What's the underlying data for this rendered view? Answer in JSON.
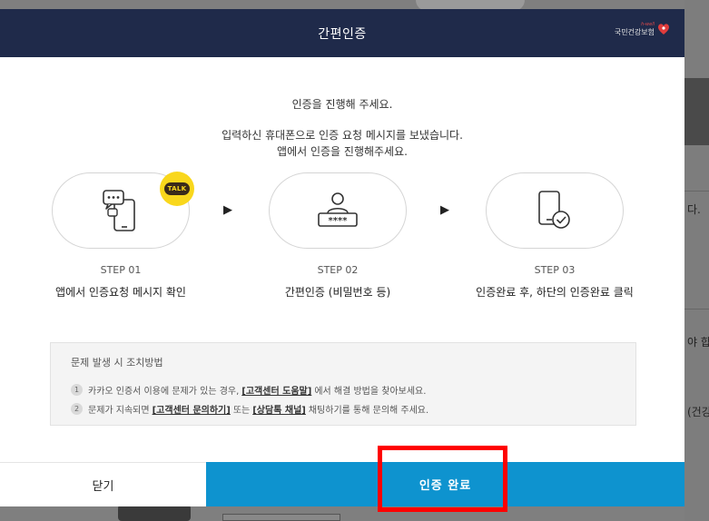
{
  "background": {
    "side_texts": [
      "다.",
      "야 합",
      "(건강"
    ]
  },
  "modal": {
    "title": "간편인증",
    "brand": {
      "small": "h-well",
      "name": "국민건강보험"
    },
    "intro_title": "인증을 진행해 주세요.",
    "intro_line1": "입력하신 휴대폰으로 인증 요청 메시지를 보냈습니다.",
    "intro_line2": "앱에서 인증을 진행해주세요.",
    "steps": [
      {
        "label": "STEP 01",
        "desc": "앱에서 인증요청 메시지 확인",
        "icon": "phone-chat-icon",
        "badge": "TALK"
      },
      {
        "label": "STEP 02",
        "desc": "간편인증 (비밀번호 등)",
        "icon": "user-password-icon"
      },
      {
        "label": "STEP 03",
        "desc": "인증완료 후, 하단의 인증완료 클릭",
        "icon": "phone-check-icon"
      }
    ],
    "help": {
      "title": "문제 발생 시 조치방법",
      "item1": {
        "num": "1",
        "pre": "카카오 인증서 이용에 문제가 있는 경우,",
        "link": "[고객센터 도움말]",
        "post": "에서 해결 방법을 찾아보세요."
      },
      "item2": {
        "num": "2",
        "pre": "문제가 지속되면",
        "link1": "[고객센터 문의하기]",
        "mid": "또는",
        "link2": "[상담톡 채널]",
        "post": "채팅하기를 통해 문의해 주세요."
      }
    },
    "buttons": {
      "close": "닫기",
      "done": "인증 완료"
    }
  },
  "colors": {
    "header": "#1f2a4a",
    "primary": "#0e93cf",
    "highlight": "#ff0000",
    "kakao": "#f9d71c"
  }
}
